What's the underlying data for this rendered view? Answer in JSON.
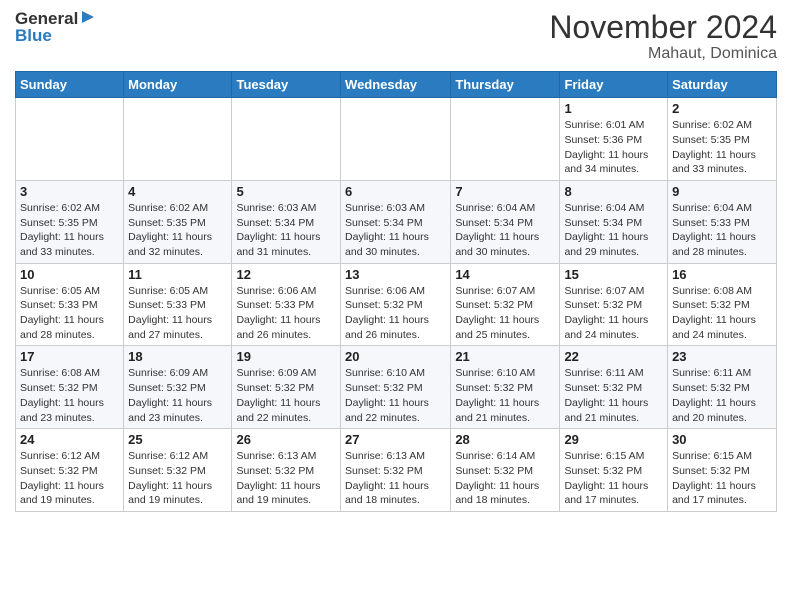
{
  "header": {
    "logo_general": "General",
    "logo_blue": "Blue",
    "month": "November 2024",
    "location": "Mahaut, Dominica"
  },
  "weekdays": [
    "Sunday",
    "Monday",
    "Tuesday",
    "Wednesday",
    "Thursday",
    "Friday",
    "Saturday"
  ],
  "weeks": [
    [
      {
        "day": "",
        "info": ""
      },
      {
        "day": "",
        "info": ""
      },
      {
        "day": "",
        "info": ""
      },
      {
        "day": "",
        "info": ""
      },
      {
        "day": "",
        "info": ""
      },
      {
        "day": "1",
        "info": "Sunrise: 6:01 AM\nSunset: 5:36 PM\nDaylight: 11 hours and 34 minutes."
      },
      {
        "day": "2",
        "info": "Sunrise: 6:02 AM\nSunset: 5:35 PM\nDaylight: 11 hours and 33 minutes."
      }
    ],
    [
      {
        "day": "3",
        "info": "Sunrise: 6:02 AM\nSunset: 5:35 PM\nDaylight: 11 hours and 33 minutes."
      },
      {
        "day": "4",
        "info": "Sunrise: 6:02 AM\nSunset: 5:35 PM\nDaylight: 11 hours and 32 minutes."
      },
      {
        "day": "5",
        "info": "Sunrise: 6:03 AM\nSunset: 5:34 PM\nDaylight: 11 hours and 31 minutes."
      },
      {
        "day": "6",
        "info": "Sunrise: 6:03 AM\nSunset: 5:34 PM\nDaylight: 11 hours and 30 minutes."
      },
      {
        "day": "7",
        "info": "Sunrise: 6:04 AM\nSunset: 5:34 PM\nDaylight: 11 hours and 30 minutes."
      },
      {
        "day": "8",
        "info": "Sunrise: 6:04 AM\nSunset: 5:34 PM\nDaylight: 11 hours and 29 minutes."
      },
      {
        "day": "9",
        "info": "Sunrise: 6:04 AM\nSunset: 5:33 PM\nDaylight: 11 hours and 28 minutes."
      }
    ],
    [
      {
        "day": "10",
        "info": "Sunrise: 6:05 AM\nSunset: 5:33 PM\nDaylight: 11 hours and 28 minutes."
      },
      {
        "day": "11",
        "info": "Sunrise: 6:05 AM\nSunset: 5:33 PM\nDaylight: 11 hours and 27 minutes."
      },
      {
        "day": "12",
        "info": "Sunrise: 6:06 AM\nSunset: 5:33 PM\nDaylight: 11 hours and 26 minutes."
      },
      {
        "day": "13",
        "info": "Sunrise: 6:06 AM\nSunset: 5:32 PM\nDaylight: 11 hours and 26 minutes."
      },
      {
        "day": "14",
        "info": "Sunrise: 6:07 AM\nSunset: 5:32 PM\nDaylight: 11 hours and 25 minutes."
      },
      {
        "day": "15",
        "info": "Sunrise: 6:07 AM\nSunset: 5:32 PM\nDaylight: 11 hours and 24 minutes."
      },
      {
        "day": "16",
        "info": "Sunrise: 6:08 AM\nSunset: 5:32 PM\nDaylight: 11 hours and 24 minutes."
      }
    ],
    [
      {
        "day": "17",
        "info": "Sunrise: 6:08 AM\nSunset: 5:32 PM\nDaylight: 11 hours and 23 minutes."
      },
      {
        "day": "18",
        "info": "Sunrise: 6:09 AM\nSunset: 5:32 PM\nDaylight: 11 hours and 23 minutes."
      },
      {
        "day": "19",
        "info": "Sunrise: 6:09 AM\nSunset: 5:32 PM\nDaylight: 11 hours and 22 minutes."
      },
      {
        "day": "20",
        "info": "Sunrise: 6:10 AM\nSunset: 5:32 PM\nDaylight: 11 hours and 22 minutes."
      },
      {
        "day": "21",
        "info": "Sunrise: 6:10 AM\nSunset: 5:32 PM\nDaylight: 11 hours and 21 minutes."
      },
      {
        "day": "22",
        "info": "Sunrise: 6:11 AM\nSunset: 5:32 PM\nDaylight: 11 hours and 21 minutes."
      },
      {
        "day": "23",
        "info": "Sunrise: 6:11 AM\nSunset: 5:32 PM\nDaylight: 11 hours and 20 minutes."
      }
    ],
    [
      {
        "day": "24",
        "info": "Sunrise: 6:12 AM\nSunset: 5:32 PM\nDaylight: 11 hours and 19 minutes."
      },
      {
        "day": "25",
        "info": "Sunrise: 6:12 AM\nSunset: 5:32 PM\nDaylight: 11 hours and 19 minutes."
      },
      {
        "day": "26",
        "info": "Sunrise: 6:13 AM\nSunset: 5:32 PM\nDaylight: 11 hours and 19 minutes."
      },
      {
        "day": "27",
        "info": "Sunrise: 6:13 AM\nSunset: 5:32 PM\nDaylight: 11 hours and 18 minutes."
      },
      {
        "day": "28",
        "info": "Sunrise: 6:14 AM\nSunset: 5:32 PM\nDaylight: 11 hours and 18 minutes."
      },
      {
        "day": "29",
        "info": "Sunrise: 6:15 AM\nSunset: 5:32 PM\nDaylight: 11 hours and 17 minutes."
      },
      {
        "day": "30",
        "info": "Sunrise: 6:15 AM\nSunset: 5:32 PM\nDaylight: 11 hours and 17 minutes."
      }
    ]
  ]
}
